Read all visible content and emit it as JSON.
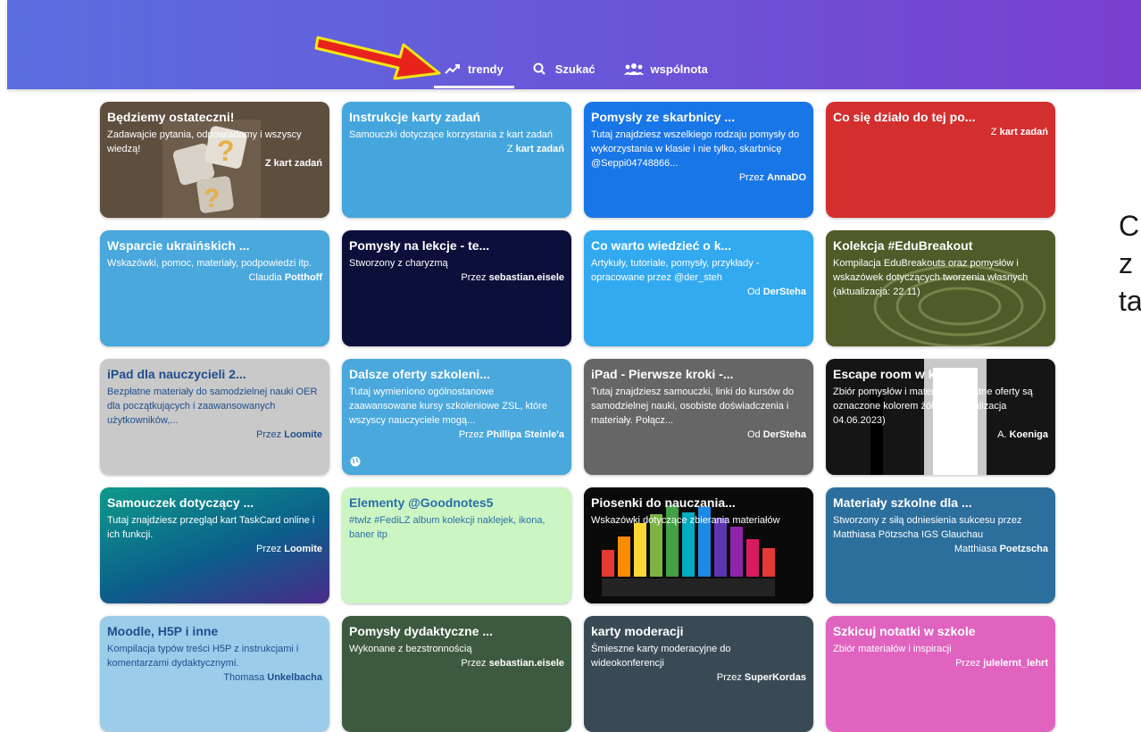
{
  "nav": {
    "items": [
      {
        "label": "trendy",
        "icon": "trending-up-icon",
        "active": true
      },
      {
        "label": "Szukać",
        "icon": "search-icon",
        "active": false
      },
      {
        "label": "wspólnota",
        "icon": "community-icon",
        "active": false
      }
    ]
  },
  "cards": [
    {
      "title": "Będziemy ostateczni!",
      "desc": "Zadawajcie pytania, odpowiadamy i wszyscy wiedzą!",
      "author_prefix": "",
      "author_name": "Z kart zadań",
      "color": "#6b5a48"
    },
    {
      "title": "Instrukcje karty zadań",
      "desc": "Samouczki dotyczące korzystania z kart zadań",
      "author_prefix": "Z ",
      "author_name": "kart zadań",
      "color": "#45a6dd"
    },
    {
      "title": "Pomysły ze skarbnicy ...",
      "desc": "Tutaj znajdziesz wszelkiego rodzaju pomysły do wykorzystania w klasie i nie tylko, skarbnicę @Seppi04748866...",
      "author_prefix": "Przez ",
      "author_name": "AnnaDO",
      "color": "#1976e6"
    },
    {
      "title": "Co się działo do tej po...",
      "desc": "",
      "author_prefix": "Z ",
      "author_name": "kart zadań",
      "color": "#d32f2f"
    },
    {
      "title": "Wsparcie ukraińskich ...",
      "desc": "Wskazówki, pomoc, materiały, podpowiedzi itp.",
      "author_prefix": "Claudia ",
      "author_name": "Potthoff",
      "color": "#4aa8dc"
    },
    {
      "title": "Pomysły na lekcje - te...",
      "desc": "Stworzony z charyzmą",
      "author_prefix": "Przez ",
      "author_name": "sebastian.eisele",
      "color": "#0c0f3a"
    },
    {
      "title": "Co warto wiedzieć o k...",
      "desc": "Artykuły, tutoriale, pomysły, przykłady - opracowane przez @der_steh",
      "author_prefix": "Od ",
      "author_name": "DerSteha",
      "color": "#33a9f0"
    },
    {
      "title": "Kolekcja #EduBreakout",
      "desc": "Kompilacja EduBreakouts oraz pomysłów i wskazówek dotyczących tworzenia własnych (aktualizacja: 22.11)",
      "author_prefix": "",
      "author_name": "",
      "color": "#5a6a2e"
    },
    {
      "title": "iPad dla nauczycieli 2...",
      "desc": "Bezpłatne materiały do samodzielnej nauki OER dla początkujących i zaawansowanych użytkowników,...",
      "author_prefix": "Przez ",
      "author_name": "Loomite",
      "color": "#c9c9c9"
    },
    {
      "title": "Dalsze oferty szkoleni...",
      "desc": "Tutaj wymieniono ogólnostanowe zaawansowane kursy szkoleniowe ZSL, które wszyscy nauczyciele mogą...",
      "author_prefix": "Przez ",
      "author_name": "Phillipa Steinle'a",
      "color": "#4aa8dc"
    },
    {
      "title": "iPad - Pierwsze kroki -...",
      "desc": "Tutaj znajdziesz samouczki, linki do kursów do samodzielnej nauki, osobiste doświadczenia i materiały. Połącz...",
      "author_prefix": "Od ",
      "author_name": "DerSteha",
      "color": "#666666"
    },
    {
      "title": "Escape room w klasie",
      "desc": "Zbiór pomysłów i materiałów - płatne oferty są oznaczone kolorem żółtym (aktualizacja 04.06.2023)",
      "author_prefix": "A. ",
      "author_name": "Koeniga",
      "color": "#1e1e1e"
    },
    {
      "title": "Samouczek dotyczący ...",
      "desc": "Tutaj znajdziesz przegląd kart TaskCard online i ich funkcji.",
      "author_prefix": "Przez ",
      "author_name": "Loomite",
      "color": "#0f8c8c"
    },
    {
      "title": "Elementy @Goodnotes5",
      "desc": "#twlz #FediLZ album kolekcji naklejek, ikona, baner itp",
      "author_prefix": "",
      "author_name": "",
      "color": "#ccf5c4"
    },
    {
      "title": "Piosenki do nauczania...",
      "desc": "Wskazówki dotyczące zbierania materiałów",
      "author_prefix": "",
      "author_name": "",
      "color": "#111111"
    },
    {
      "title": "Materiały szkolne dla ...",
      "desc": "Stworzony z siłą odniesienia sukcesu przez Matthiasa Pötzscha IGS Glauchau",
      "author_prefix": "Matthiasa ",
      "author_name": "Poetzscha",
      "color": "#2c6e9c"
    },
    {
      "title": "Moodle, H5P i inne",
      "desc": "Kompilacja typów treści H5P z instrukcjami i komentarzami dydaktycznymi.",
      "author_prefix": "Thomasa ",
      "author_name": "Unkelbacha",
      "color": "#9bcdeb"
    },
    {
      "title": "Pomysły dydaktyczne ...",
      "desc": "Wykonane z bezstronnością",
      "author_prefix": "Przez ",
      "author_name": "sebastian.eisele",
      "color": "#3d5a40"
    },
    {
      "title": "karty moderacji",
      "desc": "Śmieszne karty moderacyjne do wideokonferencji",
      "author_prefix": "Przez ",
      "author_name": "SuperKordas",
      "color": "#3a4a55"
    },
    {
      "title": "Szkicuj notatki w szkole",
      "desc": "Zbiór materiałów i inspiracji",
      "author_prefix": "Przez ",
      "author_name": "julelernt_lehrt",
      "color": "#e063c0"
    }
  ],
  "side_text": [
    "C",
    "z",
    "ta"
  ]
}
